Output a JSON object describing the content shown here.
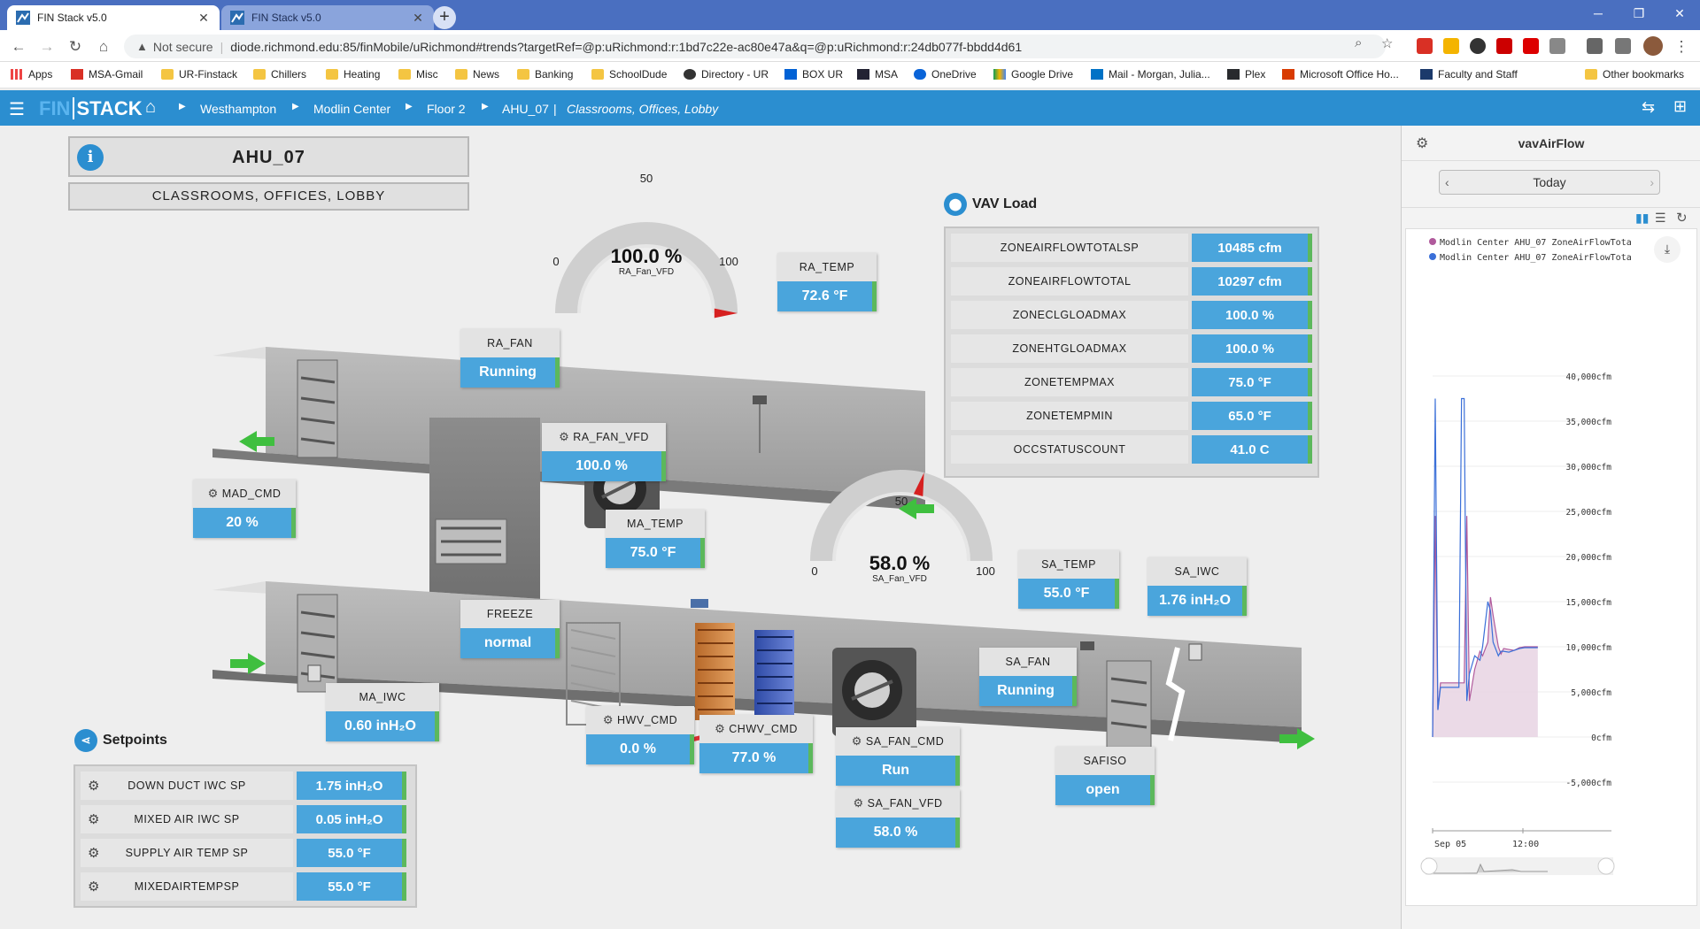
{
  "browser": {
    "tabs": [
      {
        "title": "FIN Stack v5.0",
        "active": true
      },
      {
        "title": "FIN Stack v5.0",
        "active": false
      }
    ],
    "security_label": "Not secure",
    "url": "diode.richmond.edu:85/finMobile/uRichmond#trends?targetRef=@p:uRichmond:r:1bd7c22e-ac80e47a&q=@p:uRichmond:r:24db077f-bbdd4d61",
    "bookmarks": [
      "Apps",
      "MSA-Gmail",
      "UR-Finstack",
      "Chillers",
      "Heating",
      "Misc",
      "News",
      "Banking",
      "SchoolDude",
      "Directory - UR",
      "BOX UR",
      "MSA",
      "OneDrive",
      "Google Drive",
      "Mail - Morgan, Julia...",
      "Plex",
      "Microsoft Office Ho...",
      "Faculty and Staff"
    ],
    "other_bookmarks": "Other bookmarks"
  },
  "header": {
    "logo_left": "FIN",
    "logo_right": "STACK",
    "breadcrumbs": [
      "Westhampton",
      "Modlin Center",
      "Floor 2",
      "AHU_07"
    ],
    "sub_title": "Classrooms, Offices, Lobby"
  },
  "unit": {
    "name": "AHU_07",
    "description": "CLASSROOMS, OFFICES, LOBBY"
  },
  "points": {
    "ra_temp": {
      "label": "RA_TEMP",
      "value": "72.6 °F"
    },
    "ra_fan": {
      "label": "RA_FAN",
      "value": "Running"
    },
    "ra_fan_vfd": {
      "label": "RA_FAN_VFD",
      "value": "100.0 %"
    },
    "mad_cmd": {
      "label": "MAD_CMD",
      "value": "20 %"
    },
    "ma_temp": {
      "label": "MA_TEMP",
      "value": "75.0 °F"
    },
    "freeze": {
      "label": "FREEZE",
      "value": "normal"
    },
    "ma_iwc": {
      "label": "MA_IWC",
      "value": "0.60 inH₂O"
    },
    "hwv_cmd": {
      "label": "HWV_CMD",
      "value": "0.0 %"
    },
    "chwv_cmd": {
      "label": "CHWV_CMD",
      "value": "77.0 %"
    },
    "sa_fan_cmd": {
      "label": "SA_FAN_CMD",
      "value": "Run"
    },
    "sa_fan_vfd": {
      "label": "SA_FAN_VFD",
      "value": "58.0 %"
    },
    "sa_temp": {
      "label": "SA_TEMP",
      "value": "55.0 °F"
    },
    "sa_iwc": {
      "label": "SA_IWC",
      "value": "1.76 inH₂O"
    },
    "sa_fan": {
      "label": "SA_FAN",
      "value": "Running"
    },
    "safiso": {
      "label": "SAFISO",
      "value": "open"
    }
  },
  "gauges": {
    "ra": {
      "value": "100.0 %",
      "name": "RA_Fan_VFD",
      "min": "0",
      "mid": "50",
      "max": "100",
      "percent": 100
    },
    "sa": {
      "value": "58.0 %",
      "name": "SA_Fan_VFD",
      "min": "0",
      "mid": "50",
      "max": "100",
      "percent": 58
    }
  },
  "vav_load": {
    "title": "VAV Load",
    "rows": [
      {
        "label": "ZONEAIRFLOWTOTALSP",
        "value": "10485 cfm"
      },
      {
        "label": "ZONEAIRFLOWTOTAL",
        "value": "10297 cfm"
      },
      {
        "label": "ZONECLGLOADMAX",
        "value": "100.0 %"
      },
      {
        "label": "ZONEHTGLOADMAX",
        "value": "100.0 %"
      },
      {
        "label": "ZONETEMPMAX",
        "value": "75.0 °F"
      },
      {
        "label": "ZONETEMPMIN",
        "value": "65.0 °F"
      },
      {
        "label": "OCCSTATUSCOUNT",
        "value": "41.0 C"
      }
    ]
  },
  "setpoints": {
    "title": "Setpoints",
    "rows": [
      {
        "label": "DOWN DUCT IWC SP",
        "value": "1.75 inH₂O"
      },
      {
        "label": "MIXED AIR IWC SP",
        "value": "0.05 inH₂O"
      },
      {
        "label": "SUPPLY AIR TEMP SP",
        "value": "55.0 °F"
      },
      {
        "label": "MIXEDAIRTEMPSP",
        "value": "55.0 °F"
      }
    ]
  },
  "trend_panel": {
    "title": "vavAirFlow",
    "date_label": "Today",
    "legend": [
      "Modlin Center AHU_07 ZoneAirFlowTota",
      "Modlin Center AHU_07 ZoneAirFlowTota"
    ],
    "colors": {
      "series1": "#b05a9c",
      "series2": "#3a6fd8",
      "fill": "#e8d3e3"
    }
  },
  "chart_data": {
    "type": "line",
    "title": "vavAirFlow",
    "ylabel": "cfm",
    "ylim": [
      -5000,
      40000
    ],
    "y_ticks": [
      "-5,000cfm",
      "0cfm",
      "5,000cfm",
      "10,000cfm",
      "15,000cfm",
      "20,000cfm",
      "25,000cfm",
      "30,000cfm",
      "35,000cfm",
      "40,000cfm"
    ],
    "x_ticks": [
      "Sep 05",
      "12:00"
    ],
    "series": [
      {
        "name": "Modlin Center AHU_07 ZoneAirFlowTota",
        "type": "area",
        "x": [
          0,
          1,
          2,
          3,
          6,
          10,
          12,
          13,
          14,
          16,
          18,
          19,
          21,
          22,
          23,
          25,
          26,
          27,
          29,
          31,
          33,
          35,
          37,
          40
        ],
        "y": [
          0,
          24500,
          3000,
          6000,
          6000,
          6000,
          6000,
          24500,
          4000,
          7500,
          9500,
          9000,
          10500,
          15500,
          13500,
          10000,
          9200,
          9800,
          9700,
          9600,
          9900,
          10000,
          10000,
          10000
        ]
      },
      {
        "name": "Modlin Center AHU_07 ZoneAirFlowTota",
        "type": "line",
        "x": [
          0,
          1,
          2,
          3,
          6,
          10,
          11,
          12,
          13,
          14,
          16,
          18,
          19,
          21,
          22,
          23,
          25,
          26,
          27,
          29,
          31,
          33,
          35,
          37,
          40
        ],
        "y": [
          0,
          37500,
          3000,
          5500,
          5500,
          5500,
          37500,
          37500,
          4000,
          7000,
          9000,
          8500,
          10000,
          15000,
          14000,
          10500,
          9000,
          9500,
          9500,
          9400,
          9600,
          9800,
          9900,
          9900,
          9900
        ]
      }
    ]
  }
}
